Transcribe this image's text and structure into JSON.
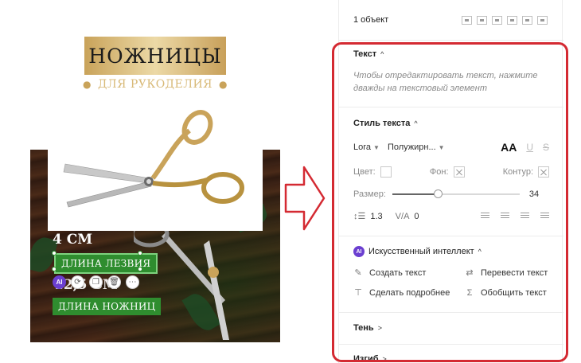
{
  "card": {
    "title": "НОЖНИЦЫ",
    "subtitle": "ДЛЯ РУКОДЕЛИЯ",
    "blade_value": "4 СМ",
    "blade_label": "ДЛИНА ЛЕЗВИЯ",
    "length_value": "12,5 СМ",
    "length_label": "ДЛИНА НОЖНИЦ",
    "toolbar": {
      "ai_label": "AI"
    }
  },
  "panel": {
    "selection": "1 объект",
    "text_section": {
      "title": "Текст",
      "hint": "Чтобы отредактировать текст, нажмите дважды на текстовый элемент"
    },
    "style_section": {
      "title": "Стиль текста",
      "font": "Lora",
      "weight": "Полужирн...",
      "case_label": "AA",
      "underline_label": "U",
      "strike_label": "S",
      "color_label": "Цвет:",
      "bg_label": "Фон:",
      "outline_label": "Контур:",
      "size_label": "Размер:",
      "size_value": "34",
      "size_fraction": 0.36,
      "line_height": "1.3",
      "letter_spacing_icon": "V/A",
      "letter_spacing": "0"
    },
    "ai_section": {
      "badge": "AI",
      "title": "Искусственный интеллект",
      "actions": [
        "Создать текст",
        "Перевести текст",
        "Сделать подробнее",
        "Обобщить текст"
      ]
    },
    "shadow_title": "Тень",
    "curve_title": "Изгиб"
  },
  "colors": {
    "highlight_frame": "#d42a32",
    "badge_green": "#2f8d2f",
    "gold": "#c9a35a",
    "ai_purple": "#6b3fd0"
  }
}
